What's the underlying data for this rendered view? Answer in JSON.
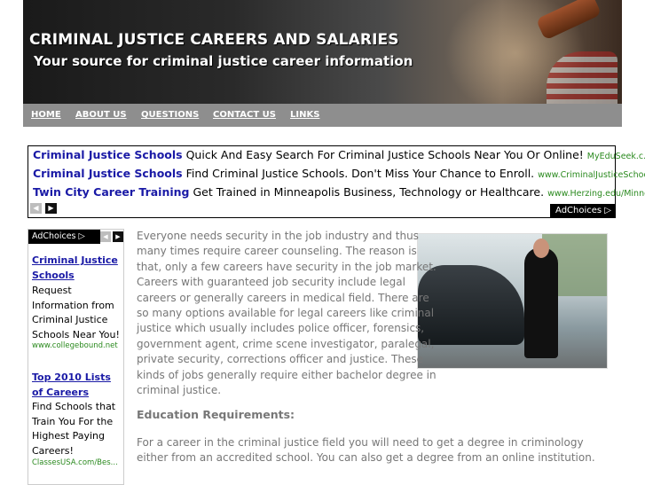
{
  "banner": {
    "title": "CRIMINAL JUSTICE CAREERS AND SALARIES",
    "subtitle": "Your source for criminal justice career information"
  },
  "nav": {
    "items": [
      {
        "label": "HOME"
      },
      {
        "label": "ABOUT US"
      },
      {
        "label": "QUESTIONS"
      },
      {
        "label": "CONTACT US"
      },
      {
        "label": "LINKS"
      }
    ]
  },
  "top_ads": {
    "rows": [
      {
        "title": "Criminal Justice Schools",
        "desc": "Quick And Easy Search For Criminal Justice Schools Near You Or Online!",
        "url": "MyEduSeek.c..."
      },
      {
        "title": "Criminal Justice Schools",
        "desc": "Find Criminal Justice Schools. Don't Miss Your Chance to Enroll.",
        "url": "www.CriminalJusticeSchoo..."
      },
      {
        "title": "Twin City Career Training",
        "desc": "Get Trained in Minneapolis Business, Technology or Healthcare.",
        "url": "www.Herzing.edu/Minnea..."
      }
    ],
    "adchoices_label": "AdChoices ▷",
    "prev_icon": "◀",
    "next_icon": "▶"
  },
  "side_ads": {
    "adchoices_label": "AdChoices ▷",
    "items": [
      {
        "title": "Criminal Justice Schools",
        "desc": "Request Information from Criminal Justice Schools Near You!",
        "url": "www.collegebound.net"
      },
      {
        "title": "Top 2010 Lists of Careers",
        "desc": "Find Schools that Train You For the Highest Paying Careers!",
        "url": "ClassesUSA.com/Bes..."
      }
    ]
  },
  "content": {
    "paragraph1": "Everyone needs security in the job industry and thus many times require career counseling. The reason is that, only a few careers have security in the job market. Careers with guaranteed job security include legal careers or generally careers in medical field. There are so many options available for legal careers like criminal justice which usually includes police officer, forensics, government agent, crime scene investigator, paralegal, private security, corrections officer and justice. These kinds of jobs generally require either bachelor degree in criminal justice.",
    "heading": "Education Requirements:",
    "paragraph2": "For a career in the criminal justice field you will need to get a degree in criminology either from an accredited school. You can also get a degree from an online institution."
  },
  "colors": {
    "nav_bg": "#8e8e8e",
    "ad_title": "#1a1aa6",
    "ad_url": "#2b8a1f",
    "body_text": "#777777"
  }
}
